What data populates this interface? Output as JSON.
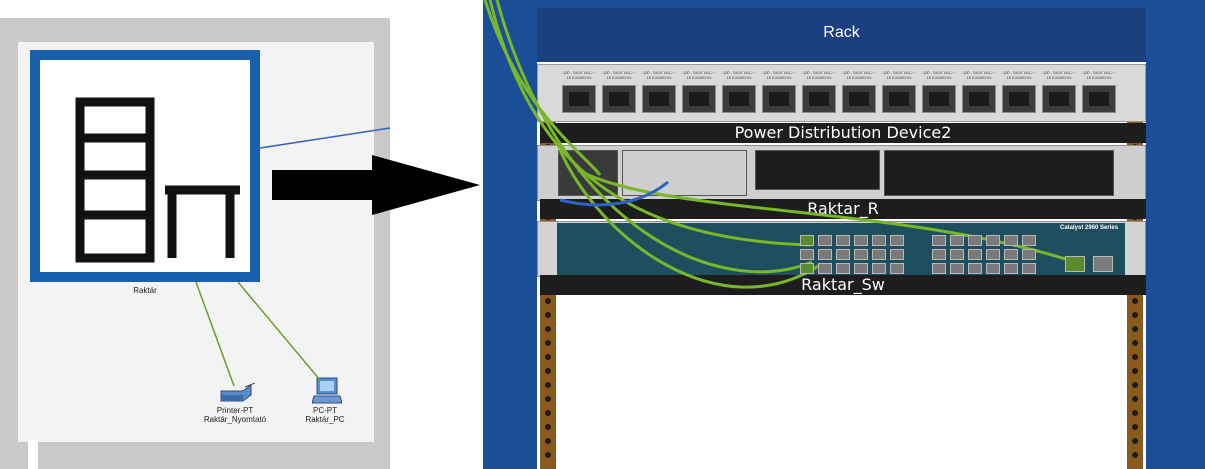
{
  "workspace": {
    "cluster_label": "Raktár",
    "printer": {
      "type": "Printer-PT",
      "name": "Raktár_Nyomtató"
    },
    "pc": {
      "type": "PC-PT",
      "name": "Raktár_PC"
    }
  },
  "rack": {
    "title": "Rack",
    "devices": {
      "pdu": "Power Distribution Device2",
      "router": "Raktar_R",
      "switch": "Raktar_Sw"
    },
    "outlet_label": "100 - 240V VAC ~ 15 A 50/60 Hz",
    "switch_brand": "Catalyst 2960 Series"
  },
  "colors": {
    "rack_frame": "#1a4f98",
    "rack_header": "#1b3f7f",
    "cable_green": "#79b72a",
    "cable_blue": "#2f62c4",
    "icon_blue": "#1a5fae"
  },
  "icons": {
    "cluster": "rack-building-icon",
    "arrow": "right-arrow-icon",
    "printer": "printer-icon",
    "pc": "pc-icon"
  }
}
